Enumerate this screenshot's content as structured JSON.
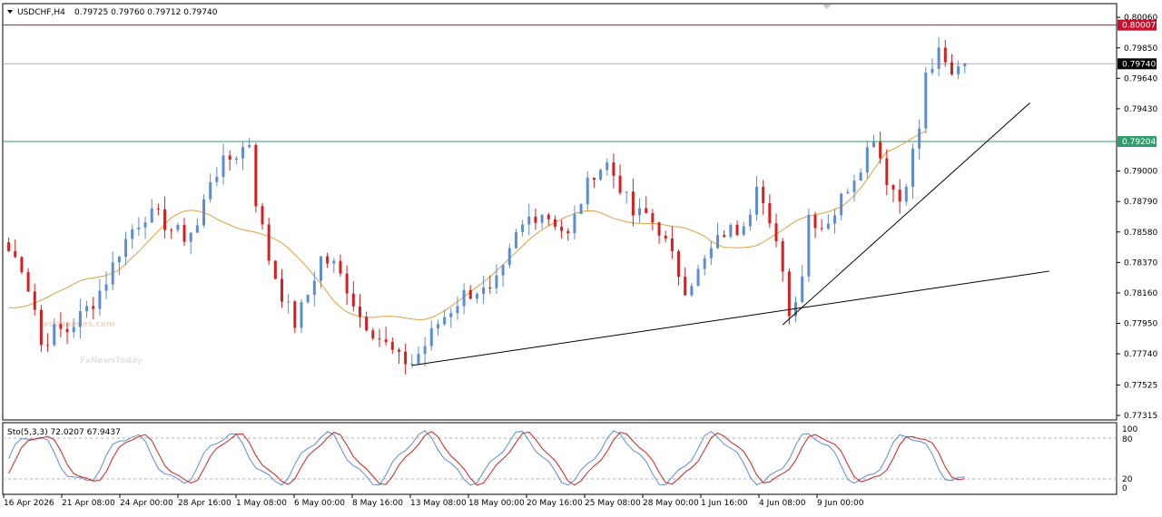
{
  "header": {
    "symbol_label": "USDCHF,H4",
    "ohlc_text": "0.79725 0.79760 0.79712 0.79740"
  },
  "oscillator": {
    "label": "Sto(5,3,3) 72.0207 67.9437",
    "levels": [
      100,
      80,
      20,
      0
    ]
  },
  "watermark": {
    "line1": "economies.com",
    "line2": "FxNewsToday"
  },
  "colors": {
    "bull": "#5b8dd6",
    "bear": "#d81e1e",
    "ma": "#e0a040",
    "resistance": "#c8102e",
    "support": "#2e9e6a",
    "current": "#b0b0b0",
    "stoch_main": "#5b8dd6",
    "stoch_signal": "#d81e1e"
  },
  "chart_data": {
    "type": "candlestick",
    "symbol": "USDCHF",
    "timeframe": "H4",
    "y_ticks": [
      "0.80060",
      "0.79850",
      "0.79640",
      "0.79430",
      "0.79000",
      "0.78790",
      "0.78580",
      "0.78370",
      "0.78160",
      "0.77950",
      "0.77740",
      "0.77525",
      "0.77315"
    ],
    "ylim": [
      0.77315,
      0.8013
    ],
    "x_ticks": [
      "16 Apr 2026",
      "21 Apr 08:00",
      "24 Apr 00:00",
      "28 Apr 16:00",
      "1 May 08:00",
      "6 May 00:00",
      "8 May 16:00",
      "13 May 08:00",
      "18 May 00:00",
      "20 May 16:00",
      "25 May 08:00",
      "28 May 00:00",
      "1 Jun 16:00",
      "4 Jun 08:00",
      "9 Jun 00:00"
    ],
    "horizontal_lines": [
      {
        "label": "0.80007",
        "value": 0.80007,
        "color": "#c8102e"
      },
      {
        "label": "0.79740",
        "value": 0.7974,
        "color": "#000000"
      },
      {
        "label": "0.79204",
        "value": 0.79204,
        "color": "#2e9e6a"
      }
    ],
    "trendlines": [
      {
        "from": [
          62,
          0.7766
        ],
        "to": [
          160,
          0.7831
        ]
      },
      {
        "from": [
          119,
          0.7794
        ],
        "to": [
          157,
          0.7947
        ]
      }
    ],
    "close_path": [
      [
        0,
        0.7845
      ],
      [
        2,
        0.7835
      ],
      [
        4,
        0.7805
      ],
      [
        5,
        0.778
      ],
      [
        7,
        0.779
      ],
      [
        9,
        0.779
      ],
      [
        11,
        0.78
      ],
      [
        13,
        0.781
      ],
      [
        15,
        0.7825
      ],
      [
        17,
        0.7845
      ],
      [
        19,
        0.786
      ],
      [
        21,
        0.787
      ],
      [
        23,
        0.7868
      ],
      [
        25,
        0.786
      ],
      [
        27,
        0.7855
      ],
      [
        29,
        0.7862
      ],
      [
        31,
        0.7895
      ],
      [
        33,
        0.7905
      ],
      [
        35,
        0.7912
      ],
      [
        37,
        0.792
      ],
      [
        38,
        0.788
      ],
      [
        40,
        0.784
      ],
      [
        42,
        0.7815
      ],
      [
        44,
        0.7795
      ],
      [
        46,
        0.7815
      ],
      [
        48,
        0.784
      ],
      [
        50,
        0.7835
      ],
      [
        52,
        0.782
      ],
      [
        54,
        0.78
      ],
      [
        56,
        0.779
      ],
      [
        58,
        0.778
      ],
      [
        60,
        0.777
      ],
      [
        62,
        0.7768
      ],
      [
        64,
        0.778
      ],
      [
        66,
        0.7795
      ],
      [
        68,
        0.7805
      ],
      [
        70,
        0.7815
      ],
      [
        72,
        0.7818
      ],
      [
        74,
        0.7815
      ],
      [
        76,
        0.783
      ],
      [
        78,
        0.7855
      ],
      [
        80,
        0.7868
      ],
      [
        82,
        0.7872
      ],
      [
        84,
        0.7865
      ],
      [
        86,
        0.7855
      ],
      [
        88,
        0.788
      ],
      [
        90,
        0.79
      ],
      [
        92,
        0.7905
      ],
      [
        94,
        0.789
      ],
      [
        96,
        0.787
      ],
      [
        98,
        0.787
      ],
      [
        100,
        0.786
      ],
      [
        102,
        0.784
      ],
      [
        104,
        0.782
      ],
      [
        106,
        0.783
      ],
      [
        108,
        0.7845
      ],
      [
        110,
        0.7858
      ],
      [
        112,
        0.786
      ],
      [
        114,
        0.7875
      ],
      [
        115,
        0.7895
      ],
      [
        117,
        0.786
      ],
      [
        119,
        0.7835
      ],
      [
        120,
        0.78
      ],
      [
        122,
        0.783
      ],
      [
        123,
        0.787
      ],
      [
        125,
        0.7862
      ],
      [
        127,
        0.7872
      ],
      [
        129,
        0.789
      ],
      [
        131,
        0.7905
      ],
      [
        133,
        0.7925
      ],
      [
        135,
        0.7895
      ],
      [
        137,
        0.788
      ],
      [
        138,
        0.7895
      ],
      [
        140,
        0.793
      ],
      [
        141,
        0.7965
      ],
      [
        143,
        0.798
      ],
      [
        145,
        0.7965
      ],
      [
        146,
        0.7975
      ],
      [
        147,
        0.7974
      ]
    ]
  }
}
